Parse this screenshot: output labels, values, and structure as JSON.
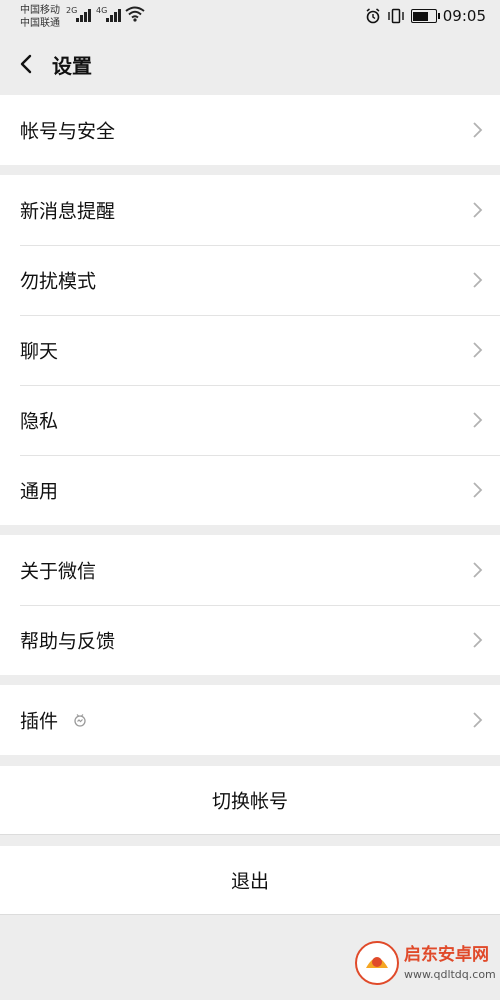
{
  "statusbar": {
    "carrier1": "中国移动",
    "carrier2": "中国联通",
    "net1": "2G",
    "net2": "4G",
    "time": "09:05",
    "icons": [
      "signal-icon",
      "wifi-icon",
      "alarm-icon",
      "vibrate-icon",
      "battery-icon"
    ]
  },
  "header": {
    "title": "设置",
    "back_icon": "chevron-left-icon"
  },
  "groups": [
    {
      "items": [
        {
          "label": "帐号与安全"
        }
      ]
    },
    {
      "items": [
        {
          "label": "新消息提醒"
        },
        {
          "label": "勿扰模式"
        },
        {
          "label": "聊天"
        },
        {
          "label": "隐私"
        },
        {
          "label": "通用"
        }
      ]
    },
    {
      "items": [
        {
          "label": "关于微信"
        },
        {
          "label": "帮助与反馈"
        }
      ]
    },
    {
      "items": [
        {
          "label": "插件",
          "icon": "plugin-icon"
        }
      ]
    }
  ],
  "actions": {
    "switch_account": "切换帐号",
    "logout": "退出"
  },
  "watermark": {
    "brand": "启东安卓网",
    "url": "www.qdltdq.com"
  }
}
